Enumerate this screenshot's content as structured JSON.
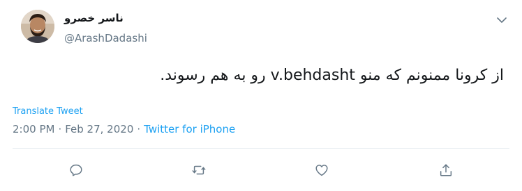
{
  "tweet": {
    "author": {
      "display_name": "ناسر خصرو",
      "handle": "@ArashDadashi",
      "avatar_icon": "user-avatar-photo"
    },
    "text": "از کرونا ممنونم که منو v.behdasht رو به هم رسوند.",
    "translate_label": "Translate Tweet",
    "time": "2:00 PM",
    "separator": "·",
    "date": "Feb 27, 2020",
    "source": "Twitter for iPhone"
  },
  "icons": {
    "menu": "chevron-down-icon",
    "reply": "reply-icon",
    "retweet": "retweet-icon",
    "like": "heart-icon",
    "share": "share-icon"
  },
  "colors": {
    "link": "#1da1f2",
    "secondary_text": "#657786",
    "primary_text": "#14171a",
    "icon": "#657786",
    "divider": "#e6ecf0"
  }
}
